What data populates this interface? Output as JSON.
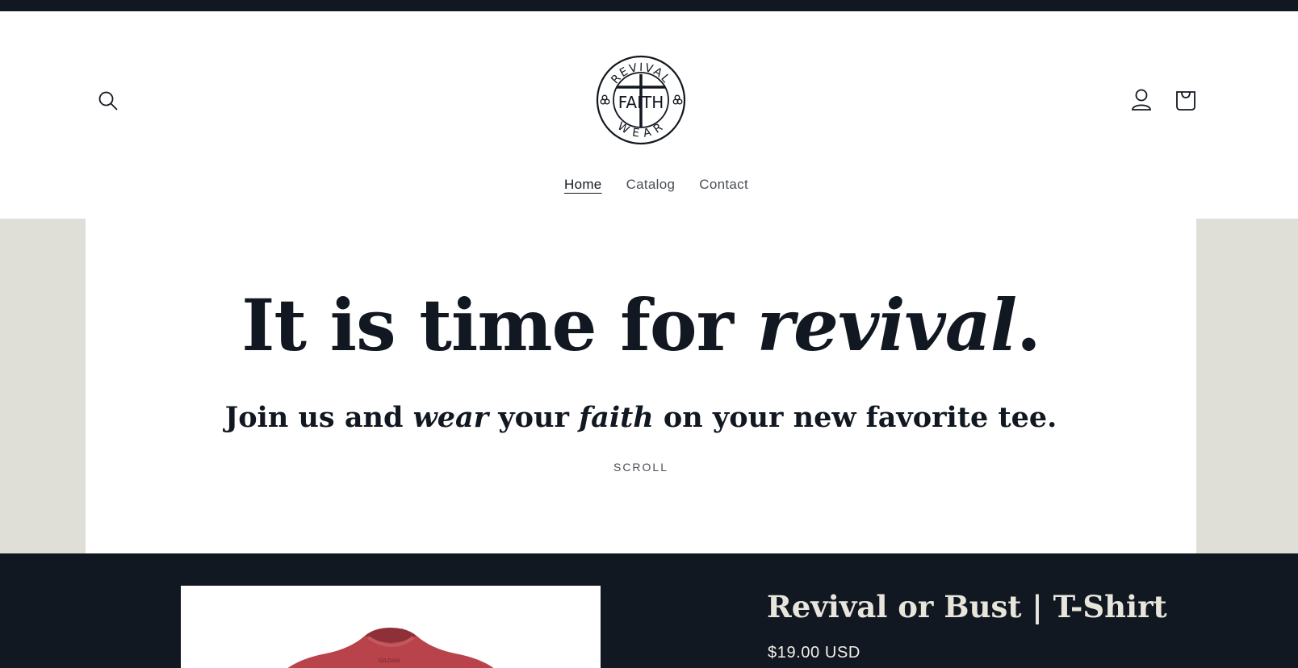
{
  "brand": {
    "logo_top_text": "REVIVAL",
    "logo_middle_text": "FAITH",
    "logo_bottom_text": "WEAR"
  },
  "header": {
    "search_icon": "search-icon",
    "account_icon": "account-icon",
    "cart_icon": "cart-icon"
  },
  "nav": {
    "items": [
      {
        "label": "Home",
        "active": true
      },
      {
        "label": "Catalog",
        "active": false
      },
      {
        "label": "Contact",
        "active": false
      }
    ]
  },
  "hero": {
    "title_plain": "It is time for ",
    "title_italic": "revival",
    "title_end": ".",
    "sub_part1": "Join us and ",
    "sub_italic1": "wear",
    "sub_part2": " your ",
    "sub_italic2": "faith",
    "sub_part3": " on your new favorite tee.",
    "scroll_label": "SCROLL"
  },
  "featured": {
    "product_title": "Revival or Bust | T-Shirt",
    "product_price": "$19.00 USD"
  },
  "colors": {
    "dark": "#121821",
    "band": "#dfdfd8",
    "shirt": "#b8434b"
  }
}
